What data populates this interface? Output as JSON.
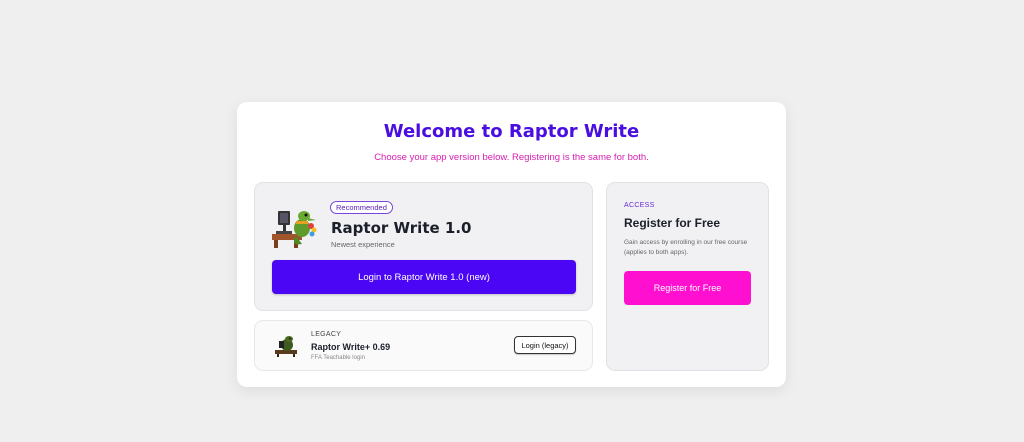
{
  "header": {
    "title": "Welcome to Raptor Write",
    "subtitle": "Choose your app version below. Registering is the same for both."
  },
  "main_app": {
    "badge": "Recommended",
    "title": "Raptor Write 1.0",
    "subtitle": "Newest experience",
    "button_label": "Login to Raptor Write 1.0 (new)"
  },
  "legacy_app": {
    "tag": "LEGACY",
    "title": "Raptor Write+ 0.69",
    "subtitle": "FFA Teachable login",
    "button_label": "Login (legacy)"
  },
  "register": {
    "tag": "ACCESS",
    "title": "Register for Free",
    "description": "Gain access by enrolling in our free course (applies to both apps).",
    "button_label": "Register for Free"
  },
  "colors": {
    "title": "#4a0fe0",
    "subtitle": "#d61fb0",
    "primary_button": "#4a06f5",
    "register_button": "#ff0fcf"
  },
  "icons": {
    "main_mascot": "raptor-mascot-at-desk-icon",
    "legacy_mascot": "raptor-mascot-small-icon"
  }
}
